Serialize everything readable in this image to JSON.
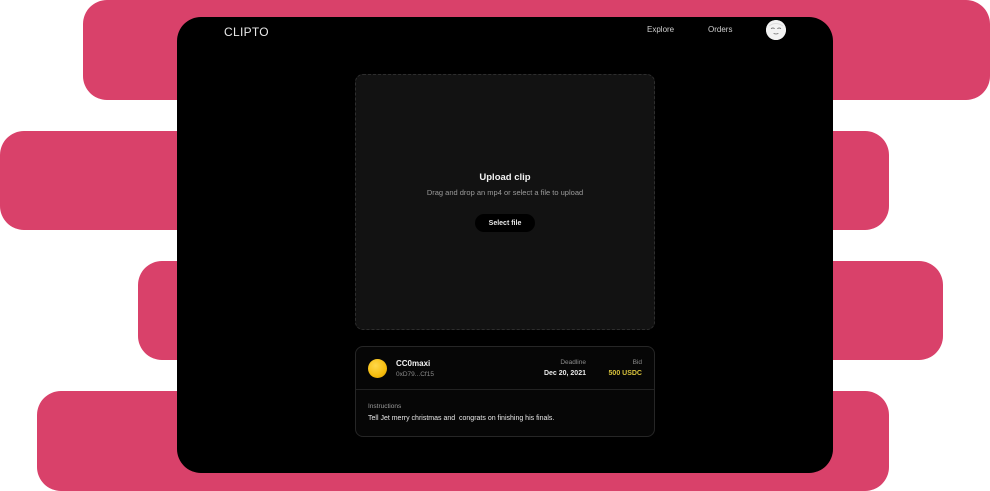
{
  "colors": {
    "accent_stripe": "#d9416a",
    "window_bg": "#000000",
    "dropzone_bg": "#121212",
    "bid_color": "#d8c23c"
  },
  "header": {
    "logo": "CLIPTO",
    "nav": {
      "explore": "Explore",
      "orders": "Orders"
    },
    "avatar_icon": "face-avatar-icon"
  },
  "upload": {
    "title": "Upload clip",
    "subtitle": "Drag and drop an mp4 or select a file to upload",
    "button": "Select file"
  },
  "order": {
    "avatar_icon": "coin-avatar-icon",
    "user_name": "CC0maxi",
    "user_address": "0xD79...Cf15",
    "deadline_label": "Deadline",
    "deadline_value": "Dec 20, 2021",
    "bid_label": "Bid",
    "bid_value": "500 USDC",
    "instructions_label": "Instructions",
    "instructions_text": "Tell Jet merry christmas and  congrats on finishing his finals."
  }
}
